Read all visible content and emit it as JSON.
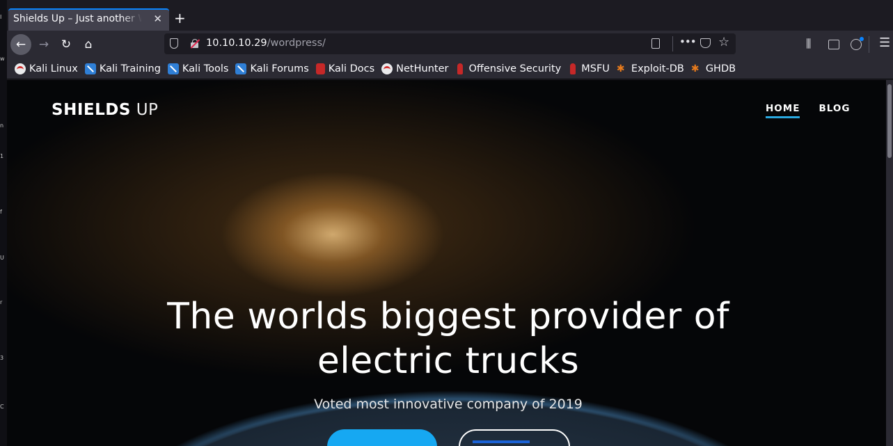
{
  "browser": {
    "tab_title": "Shields Up – Just another WordPress site",
    "tab_close": "✕",
    "new_tab": "+",
    "url_host": "10.10.10.29",
    "url_path": "/wordpress/"
  },
  "bookmarks": [
    {
      "label": "Kali Linux",
      "icon": "kali"
    },
    {
      "label": "Kali Training",
      "icon": "blue"
    },
    {
      "label": "Kali Tools",
      "icon": "blue"
    },
    {
      "label": "Kali Forums",
      "icon": "blue"
    },
    {
      "label": "Kali Docs",
      "icon": "docs"
    },
    {
      "label": "NetHunter",
      "icon": "kali"
    },
    {
      "label": "Offensive Security",
      "icon": "offsec"
    },
    {
      "label": "MSFU",
      "icon": "offsec"
    },
    {
      "label": "Exploit-DB",
      "icon": "exploit"
    },
    {
      "label": "GHDB",
      "icon": "exploit"
    }
  ],
  "site": {
    "title_bold": "SHIELDS",
    "title_light": "UP",
    "nav": [
      {
        "label": "HOME",
        "active": true
      },
      {
        "label": "BLOG",
        "active": false
      }
    ],
    "hero_line1": "The worlds biggest provider of",
    "hero_line2": "electric trucks",
    "hero_sub": "Voted most innovative company of 2019"
  },
  "colors": {
    "accent": "#16a8f2",
    "nav_underline": "#29a8e0",
    "browser_accent": "#0a84ff"
  }
}
